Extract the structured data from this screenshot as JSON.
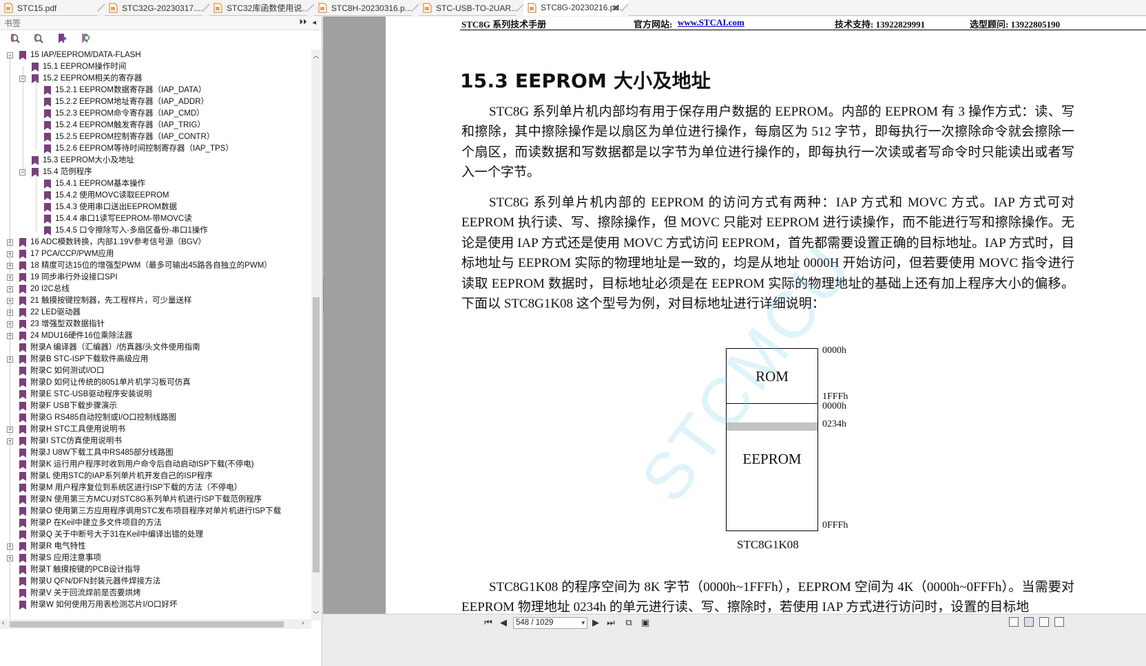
{
  "tabs": [
    {
      "label": "STC15.pdf",
      "active": false
    },
    {
      "label": "STC32G-20230317....",
      "active": false
    },
    {
      "label": "STC32库函数使用说...",
      "active": false
    },
    {
      "label": "STC8H-20230316.p...",
      "active": false
    },
    {
      "label": "STC-USB-TO-2UAR...",
      "active": false
    },
    {
      "label": "STC8G-20230216.pd...",
      "active": true
    }
  ],
  "bookmarks_panel": {
    "title": "书签",
    "tree": [
      {
        "label": "15 IAP/EEPROM/DATA-FLASH",
        "level": 0,
        "expander": "−"
      },
      {
        "label": "15.1 EEPROM操作时间",
        "level": 1,
        "expander": ""
      },
      {
        "label": "15.2 EEPROM相关的寄存器",
        "level": 1,
        "expander": "−"
      },
      {
        "label": "15.2.1 EEPROM数据寄存器（IAP_DATA）",
        "level": 2,
        "expander": ""
      },
      {
        "label": "15.2.2 EEPROM地址寄存器（IAP_ADDR）",
        "level": 2,
        "expander": ""
      },
      {
        "label": "15.2.3 EEPROM命令寄存器（IAP_CMD）",
        "level": 2,
        "expander": ""
      },
      {
        "label": "15.2.4 EEPROM触发寄存器（IAP_TRIG）",
        "level": 2,
        "expander": ""
      },
      {
        "label": "15.2.5 EEPROM控制寄存器（IAP_CONTR）",
        "level": 2,
        "expander": ""
      },
      {
        "label": "15.2.6 EEPROM等待时间控制寄存器（IAP_TPS）",
        "level": 2,
        "expander": ""
      },
      {
        "label": "15.3 EEPROM大小及地址",
        "level": 1,
        "expander": ""
      },
      {
        "label": "15.4 范例程序",
        "level": 1,
        "expander": "−"
      },
      {
        "label": "15.4.1 EEPROM基本操作",
        "level": 2,
        "expander": ""
      },
      {
        "label": "15.4.2 使用MOVC读取EEPROM",
        "level": 2,
        "expander": ""
      },
      {
        "label": "15.4.3 使用串口送出EEPROM数据",
        "level": 2,
        "expander": ""
      },
      {
        "label": "15.4.4 串口1读写EEPROM-带MOVC读",
        "level": 2,
        "expander": ""
      },
      {
        "label": "15.4.5 口令擦除写入-多扇区备份-串口1操作",
        "level": 2,
        "expander": ""
      },
      {
        "label": "16 ADC模数转换，内部1.19V参考信号源（BGV）",
        "level": 0,
        "expander": "+"
      },
      {
        "label": "17 PCA/CCP/PWM应用",
        "level": 0,
        "expander": "+"
      },
      {
        "label": "18 精度可达15位的增强型PWM（最多可输出45路各自独立的PWM）",
        "level": 0,
        "expander": "+"
      },
      {
        "label": "19 同步串行外设接口SPI",
        "level": 0,
        "expander": "+"
      },
      {
        "label": "20 I2C总线",
        "level": 0,
        "expander": "+"
      },
      {
        "label": "21 触摸按键控制器，先工程样片，可少量送样",
        "level": 0,
        "expander": "+"
      },
      {
        "label": "22 LED驱动器",
        "level": 0,
        "expander": "+"
      },
      {
        "label": "23 增强型双数据指针",
        "level": 0,
        "expander": "+"
      },
      {
        "label": "24 MDU16硬件16位乘除法器",
        "level": 0,
        "expander": "+"
      },
      {
        "label": "附录A 编译器（汇编器）/仿真器/头文件使用指南",
        "level": 0,
        "expander": ""
      },
      {
        "label": "附录B STC-ISP下载软件高级应用",
        "level": 0,
        "expander": "+"
      },
      {
        "label": "附录C 如何测试I/O口",
        "level": 0,
        "expander": ""
      },
      {
        "label": "附录D 如何让传统的8051单片机学习板可仿真",
        "level": 0,
        "expander": ""
      },
      {
        "label": "附录E STC-USB驱动程序安装说明",
        "level": 0,
        "expander": ""
      },
      {
        "label": "附录F USB下载步骤演示",
        "level": 0,
        "expander": ""
      },
      {
        "label": "附录G RS485自动控制或I/O口控制线路图",
        "level": 0,
        "expander": ""
      },
      {
        "label": "附录H STC工具使用说明书",
        "level": 0,
        "expander": "+"
      },
      {
        "label": "附录I STC仿真使用说明书",
        "level": 0,
        "expander": "+"
      },
      {
        "label": "附录J U8W下载工具中RS485部分线路图",
        "level": 0,
        "expander": ""
      },
      {
        "label": "附录K 运行用户程序时收到用户命令后自动启动ISP下载(不停电)",
        "level": 0,
        "expander": ""
      },
      {
        "label": "附录L 使用STC的IAP系列单片机开发自己的ISP程序",
        "level": 0,
        "expander": ""
      },
      {
        "label": "附录M 用户程序复位到系统区进行ISP下载的方法（不停电）",
        "level": 0,
        "expander": ""
      },
      {
        "label": "附录N 使用第三方MCU对STC8G系列单片机进行ISP下载范例程序",
        "level": 0,
        "expander": ""
      },
      {
        "label": "附录O 使用第三方应用程序调用STC发布项目程序对单片机进行ISP下载",
        "level": 0,
        "expander": ""
      },
      {
        "label": "附录P 在Keil中建立多文件项目的方法",
        "level": 0,
        "expander": ""
      },
      {
        "label": "附录Q 关于中断号大于31在Keil中编译出错的处理",
        "level": 0,
        "expander": ""
      },
      {
        "label": "附录R 电气特性",
        "level": 0,
        "expander": "+"
      },
      {
        "label": "附录S 应用注意事项",
        "level": 0,
        "expander": "+"
      },
      {
        "label": "附录T 触摸按键的PCB设计指导",
        "level": 0,
        "expander": ""
      },
      {
        "label": "附录U QFN/DFN封装元器件焊接方法",
        "level": 0,
        "expander": ""
      },
      {
        "label": "附录V 关于回流焊前是否要烘烤",
        "level": 0,
        "expander": ""
      },
      {
        "label": "附录W 如何使用万用表检测芯片I/O口好坏",
        "level": 0,
        "expander": ""
      }
    ]
  },
  "page": {
    "header": {
      "manual": "STC8G 系列技术手册",
      "site_label": "官方网站:",
      "site_url": "www.STCAI.com",
      "support": "技术支持: 13922829991",
      "sales": "选型顾问: 13922805190"
    },
    "section_title": "15.3   EEPROM 大小及地址",
    "para1": "STC8G 系列单片机内部均有用于保存用户数据的 EEPROM。内部的 EEPROM 有 3 操作方式：读、写和擦除，其中擦除操作是以扇区为单位进行操作，每扇区为 512 字节，即每执行一次擦除命令就会擦除一个扇区，而读数据和写数据都是以字节为单位进行操作的，即每执行一次读或者写命令时只能读出或者写入一个字节。",
    "para2": "STC8G 系列单片机内部的 EEPROM 的访问方式有两种：IAP 方式和 MOVC 方式。IAP 方式可对 EEPROM 执行读、写、擦除操作，但 MOVC 只能对 EEPROM 进行读操作，而不能进行写和擦除操作。无论是使用 IAP 方式还是使用 MOVC 方式访问 EEPROM，首先都需要设置正确的目标地址。IAP 方式时，目标地址与 EEPROM 实际的物理地址是一致的，均是从地址 0000H 开始访问，但若要使用 MOVC 指令进行读取 EEPROM 数据时，目标地址必须是在 EEPROM 实际的物理地址的基础上还有加上程序大小的偏移。下面以 STC8G1K08 这个型号为例，对目标地址进行详细说明：",
    "para3": "STC8G1K08 的程序空间为 8K 字节（0000h~1FFFh），EEPROM 空间为 4K（0000h~0FFFh）。当需要对 EEPROM 物理地址 0234h 的单元进行读、写、擦除时，若使用 IAP 方式进行访问时，设置的目标地",
    "diagram": {
      "rom_label": "ROM",
      "eeprom_label": "EEPROM",
      "addr_rom_start": "0000h",
      "addr_rom_end": "1FFFh",
      "addr_eeprom_start": "0000h",
      "addr_target": "0234h",
      "addr_eeprom_end": "0FFFh",
      "chip_label": "STC8G1K08"
    },
    "watermark": "STCMCU"
  },
  "toolbar": {
    "page_indicator": "548 / 1029"
  }
}
